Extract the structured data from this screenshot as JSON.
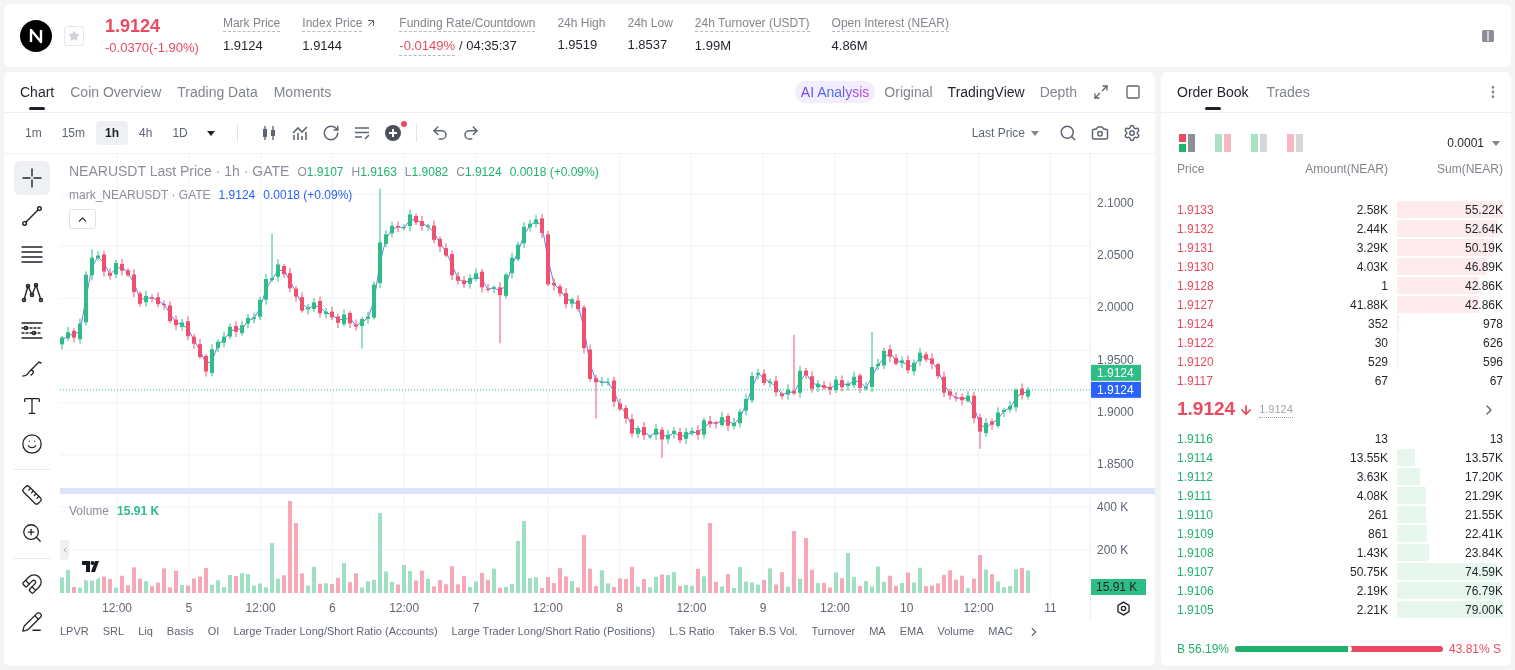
{
  "ticker": {
    "favorite": false,
    "price": "1.9124",
    "change": "-0.0370(-1.90%)",
    "rising": false
  },
  "stats": [
    {
      "label": "Mark Price",
      "value": "1.9124",
      "underlined": true,
      "kind": "plain"
    },
    {
      "label": "Index Price",
      "value": "1.9144",
      "underlined": true,
      "kind": "link"
    },
    {
      "label": "Funding Rate/Countdown",
      "value": "-0.0149%",
      "countdown": "/ 04:35:37",
      "underlined": true,
      "kind": "funding",
      "rising": false
    },
    {
      "label": "24h High",
      "value": "1.9519",
      "underlined": false,
      "kind": "plain"
    },
    {
      "label": "24h Low",
      "value": "1.8537",
      "underlined": false,
      "kind": "plain"
    },
    {
      "label": "24h Turnover (USDT)",
      "value": "1.99M",
      "underlined": true,
      "kind": "plain"
    },
    {
      "label": "Open Interest (NEAR)",
      "value": "4.86M",
      "underlined": true,
      "kind": "plain"
    }
  ],
  "chart": {
    "tabs": [
      {
        "label": "Chart",
        "selected": true
      },
      {
        "label": "Coin Overview",
        "selected": false
      },
      {
        "label": "Trading Data",
        "selected": false
      },
      {
        "label": "Moments",
        "selected": false
      }
    ],
    "ai_button": "AI Analysis",
    "views": [
      {
        "label": "Original",
        "selected": false
      },
      {
        "label": "TradingView",
        "selected": true
      },
      {
        "label": "Depth",
        "selected": false
      }
    ],
    "intervals": [
      {
        "label": "1m",
        "selected": false
      },
      {
        "label": "15m",
        "selected": false
      },
      {
        "label": "1h",
        "selected": true
      },
      {
        "label": "4h",
        "selected": false
      },
      {
        "label": "1D",
        "selected": false
      }
    ],
    "add_indicator_badge": true,
    "price_source": "Last Price",
    "drawing_tool_groups": [
      [
        {
          "kind": "crosshair",
          "selected": true
        },
        {
          "kind": "trend_line",
          "selected": false
        },
        {
          "kind": "horizontal_lines",
          "selected": false
        },
        {
          "kind": "pattern",
          "selected": false
        },
        {
          "kind": "levels",
          "selected": false
        },
        {
          "kind": "brush",
          "selected": false
        },
        {
          "kind": "text",
          "selected": false
        },
        {
          "kind": "emoji",
          "selected": false
        }
      ],
      [
        {
          "kind": "ruler",
          "selected": false
        },
        {
          "kind": "zoom",
          "selected": false
        }
      ],
      [
        {
          "kind": "magnet",
          "selected": false
        },
        {
          "kind": "pencil",
          "selected": false
        }
      ]
    ],
    "legend": {
      "title": "NEARUSDT Last Price · 1h · GATE",
      "ohlc": [
        {
          "label": "O",
          "value": "1.9107"
        },
        {
          "label": "H",
          "value": "1.9163"
        },
        {
          "label": "L",
          "value": "1.9082"
        },
        {
          "label": "C",
          "value": "1.9124"
        }
      ],
      "change": "0.0018 (+0.09%)",
      "rising": true
    },
    "mark_legend": {
      "title": "mark_NEARUSDT · GATE",
      "value": "1.9124",
      "change": "0.0018 (+0.09%)"
    },
    "price_axis": [
      "2.1000",
      "2.0500",
      "2.0000",
      "1.9500",
      "1.9000",
      "1.8500"
    ],
    "last_price_tag": "1.9124",
    "mark_price_tag": "1.9124",
    "volume_legend": {
      "label": "Volume",
      "value": "15.91 K"
    },
    "volume_axis": [
      "400 K",
      "200 K"
    ],
    "volume_tag": "15.91 K",
    "time_axis": [
      "12:00",
      "5",
      "12:00",
      "6",
      "12:00",
      "7",
      "12:00",
      "8",
      "12:00",
      "9",
      "12:00",
      "10",
      "12:00",
      "11"
    ],
    "indicators": [
      "LPVR",
      "SRL",
      "Liq",
      "Basis",
      "OI",
      "Large Trader Long/Short Ratio (Accounts)",
      "Large Trader Long/Short Ratio (Positions)",
      "L.S Ratio",
      "Taker B.S Vol.",
      "Turnover",
      "MA",
      "EMA",
      "Volume",
      "MAC"
    ]
  },
  "order_book": {
    "tabs": [
      {
        "label": "Order Book",
        "selected": true
      },
      {
        "label": "Trades",
        "selected": false
      }
    ],
    "layouts": [
      {
        "kind": "mixed",
        "selected": true
      },
      {
        "kind": "split",
        "selected": false
      },
      {
        "kind": "bids",
        "selected": false
      },
      {
        "kind": "asks",
        "selected": false
      }
    ],
    "precision": "0.0001",
    "columns": [
      "Price",
      "Amount(NEAR)",
      "Sum(NEAR)"
    ],
    "asks": [
      {
        "price": "1.9133",
        "amount": "2.58K",
        "sum": "55.22K"
      },
      {
        "price": "1.9132",
        "amount": "2.44K",
        "sum": "52.64K"
      },
      {
        "price": "1.9131",
        "amount": "3.29K",
        "sum": "50.19K"
      },
      {
        "price": "1.9130",
        "amount": "4.03K",
        "sum": "46.89K"
      },
      {
        "price": "1.9128",
        "amount": "1",
        "sum": "42.86K"
      },
      {
        "price": "1.9127",
        "amount": "41.88K",
        "sum": "42.86K"
      },
      {
        "price": "1.9124",
        "amount": "352",
        "sum": "978"
      },
      {
        "price": "1.9122",
        "amount": "30",
        "sum": "626"
      },
      {
        "price": "1.9120",
        "amount": "529",
        "sum": "596"
      },
      {
        "price": "1.9117",
        "amount": "67",
        "sum": "67"
      }
    ],
    "last_price": {
      "value": "1.9124",
      "mark": "1.9124",
      "rising": false
    },
    "bids": [
      {
        "price": "1.9116",
        "amount": "13",
        "sum": "13"
      },
      {
        "price": "1.9114",
        "amount": "13.55K",
        "sum": "13.57K"
      },
      {
        "price": "1.9112",
        "amount": "3.63K",
        "sum": "17.20K"
      },
      {
        "price": "1.9111",
        "amount": "4.08K",
        "sum": "21.29K"
      },
      {
        "price": "1.9110",
        "amount": "261",
        "sum": "21.55K"
      },
      {
        "price": "1.9109",
        "amount": "861",
        "sum": "22.41K"
      },
      {
        "price": "1.9108",
        "amount": "1.43K",
        "sum": "23.84K"
      },
      {
        "price": "1.9107",
        "amount": "50.75K",
        "sum": "74.59K"
      },
      {
        "price": "1.9106",
        "amount": "2.19K",
        "sum": "76.79K"
      },
      {
        "price": "1.9105",
        "amount": "2.21K",
        "sum": "79.00K"
      }
    ],
    "ratio": {
      "buy_label": "B 56.19%",
      "sell_label": "43.81% S",
      "level": 0.5619
    }
  }
}
